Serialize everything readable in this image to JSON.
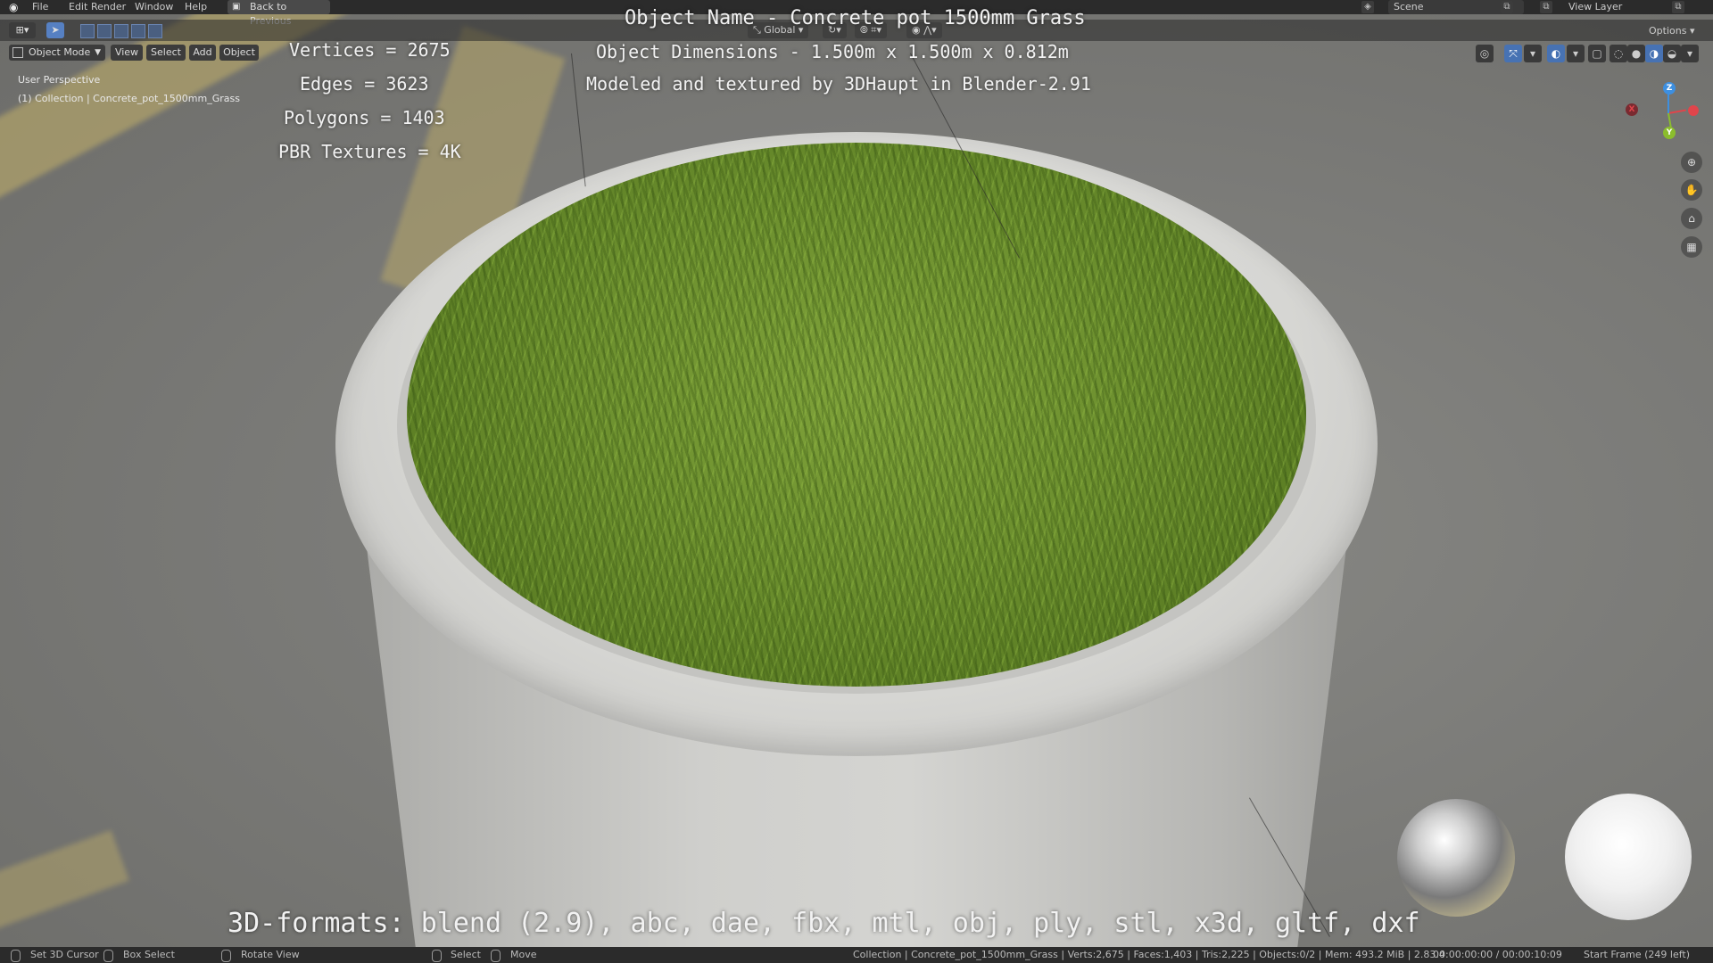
{
  "menubar": {
    "items": [
      "File",
      "Edit",
      "Render",
      "Window",
      "Help"
    ],
    "back_label": "Back to Previous",
    "scene": "Scene",
    "view_layer": "View Layer"
  },
  "header": {
    "transform_orientation": "Global",
    "options": "Options",
    "mode": "Object Mode",
    "menus": [
      "View",
      "Select",
      "Add",
      "Object"
    ]
  },
  "viewport": {
    "perspective": "User Perspective",
    "collection": "(1) Collection | Concrete_pot_1500mm_Grass"
  },
  "overlay_text": {
    "title": "Object Name - Concrete pot 1500mm Grass",
    "dimensions": "Object Dimensions -  1.500m x 1.500m x 0.812m",
    "modeled": "Modeled and textured by 3DHaupt in Blender-2.91",
    "vertices": "Vertices = 2675",
    "edges": "Edges = 3623",
    "polygons": "Polygons = 1403",
    "pbr": "PBR Textures = 4K",
    "formats": "3D-formats: blend (2.9), abc, dae, fbx, mtl, obj, ply, stl, x3d, gltf, dxf"
  },
  "gizmo": {
    "z": "Z",
    "y": "Y",
    "x": "X",
    "colors": {
      "x": "#e0454b",
      "y": "#8bbd2d",
      "z": "#3d8fe0"
    }
  },
  "statusbar": {
    "set_cursor": "Set 3D Cursor",
    "box_select": "Box Select",
    "rotate_view": "Rotate View",
    "select": "Select",
    "move": "Move",
    "stats": "Collection | Concrete_pot_1500mm_Grass | Verts:2,675 | Faces:1,403 | Tris:2,225 | Objects:0/2 | Mem: 493.2 MiB | 2.83.4",
    "time": "00:00:00:00 / 00:00:10:09",
    "start_frame": "Start Frame (249 left)"
  }
}
